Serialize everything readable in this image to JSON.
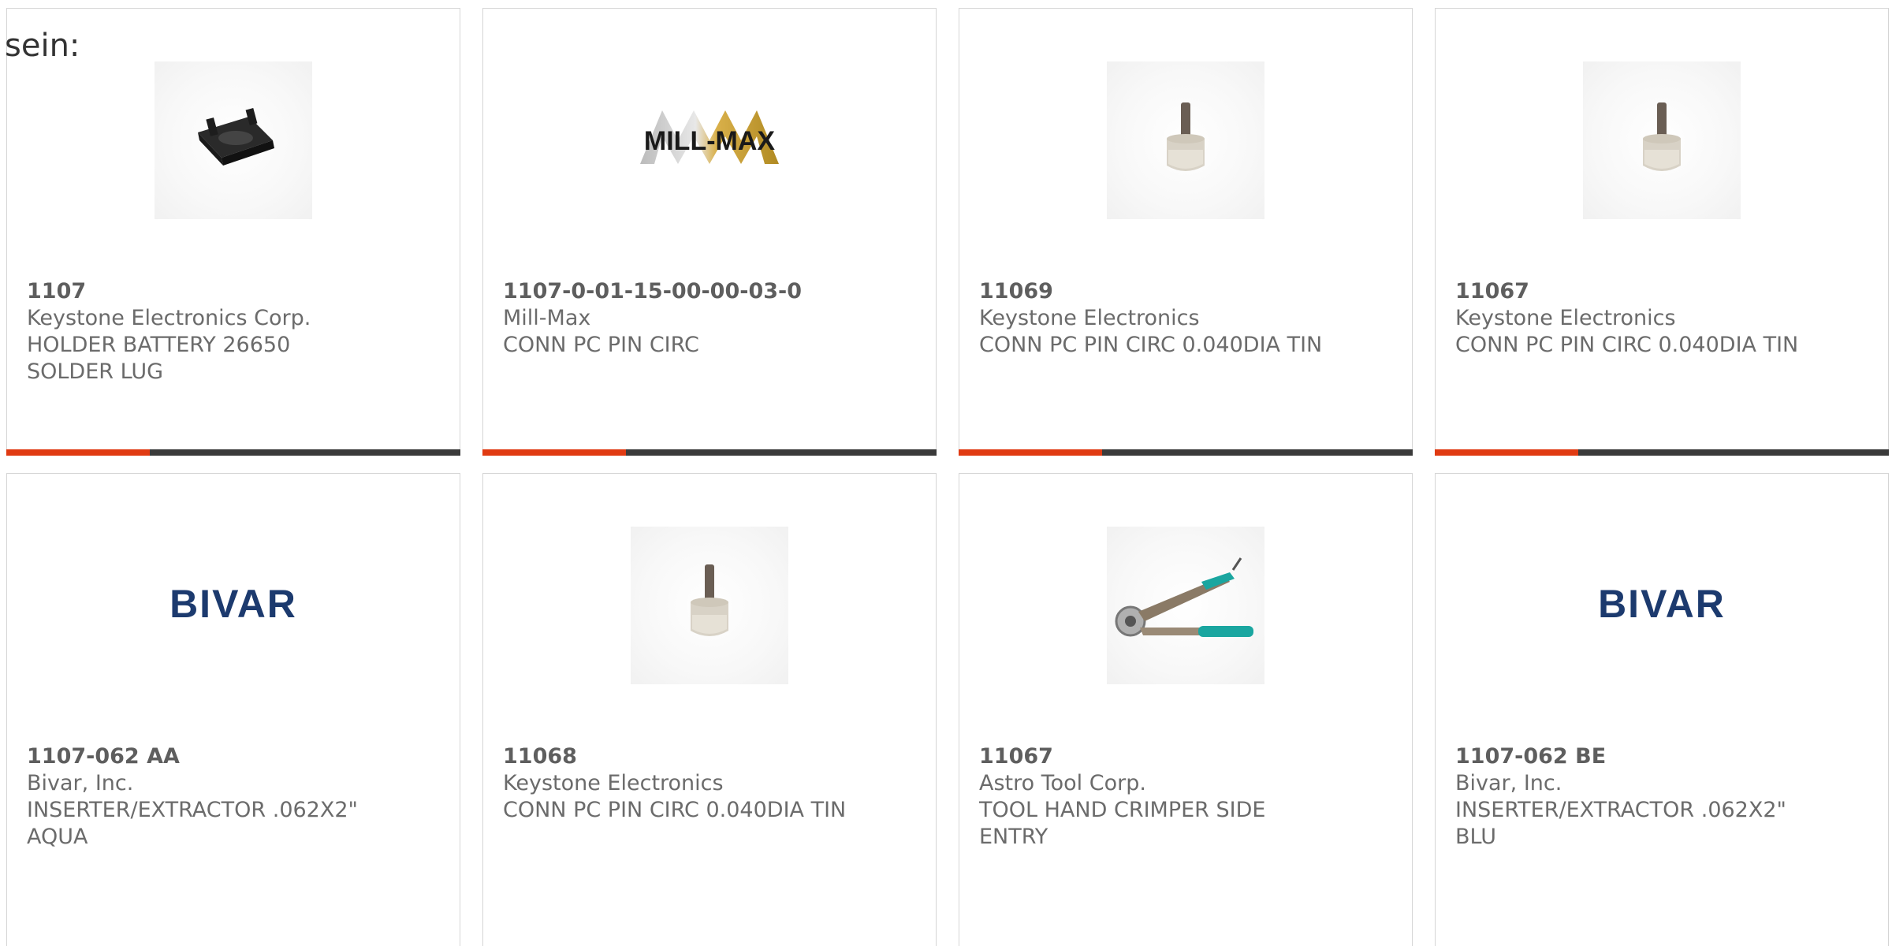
{
  "lead_text": "sein:",
  "colors": {
    "accent_bar": "#e03a12",
    "bar": "#3a3a3a",
    "card_border": "#d5d5d5",
    "text": "#6b6b6b",
    "bivar_blue": "#1c3a6e"
  },
  "products": [
    {
      "part": "1107",
      "maker": "Keystone Electronics Corp.",
      "desc": [
        "HOLDER BATTERY 26650",
        "SOLDER LUG"
      ],
      "image": "battery-holder-photo"
    },
    {
      "part": "1107-0-01-15-00-00-03-0",
      "maker": "Mill-Max",
      "desc": [
        "CONN PC PIN CIRC"
      ],
      "image": "mill-max-logo",
      "logo_text": "MILL-MAX"
    },
    {
      "part": "11069",
      "maker": "Keystone Electronics",
      "desc": [
        "CONN PC PIN CIRC 0.040DIA TIN"
      ],
      "image": "pc-pin-photo"
    },
    {
      "part": "11067",
      "maker": "Keystone Electronics",
      "desc": [
        "CONN PC PIN CIRC 0.040DIA TIN"
      ],
      "image": "pc-pin-photo"
    },
    {
      "part": "1107-062 AA",
      "maker": "Bivar, Inc.",
      "desc": [
        "INSERTER/EXTRACTOR .062X2\"",
        "AQUA"
      ],
      "image": "bivar-logo",
      "logo_text": "BIVAR"
    },
    {
      "part": "11068",
      "maker": "Keystone Electronics",
      "desc": [
        "CONN PC PIN CIRC 0.040DIA TIN"
      ],
      "image": "pc-pin-photo"
    },
    {
      "part": "11067",
      "maker": "Astro Tool Corp.",
      "desc": [
        "TOOL HAND CRIMPER SIDE",
        "ENTRY"
      ],
      "image": "crimper-tool-photo"
    },
    {
      "part": "1107-062 BE",
      "maker": "Bivar, Inc.",
      "desc": [
        "INSERTER/EXTRACTOR .062X2\"",
        "BLU"
      ],
      "image": "bivar-logo",
      "logo_text": "BIVAR"
    }
  ]
}
